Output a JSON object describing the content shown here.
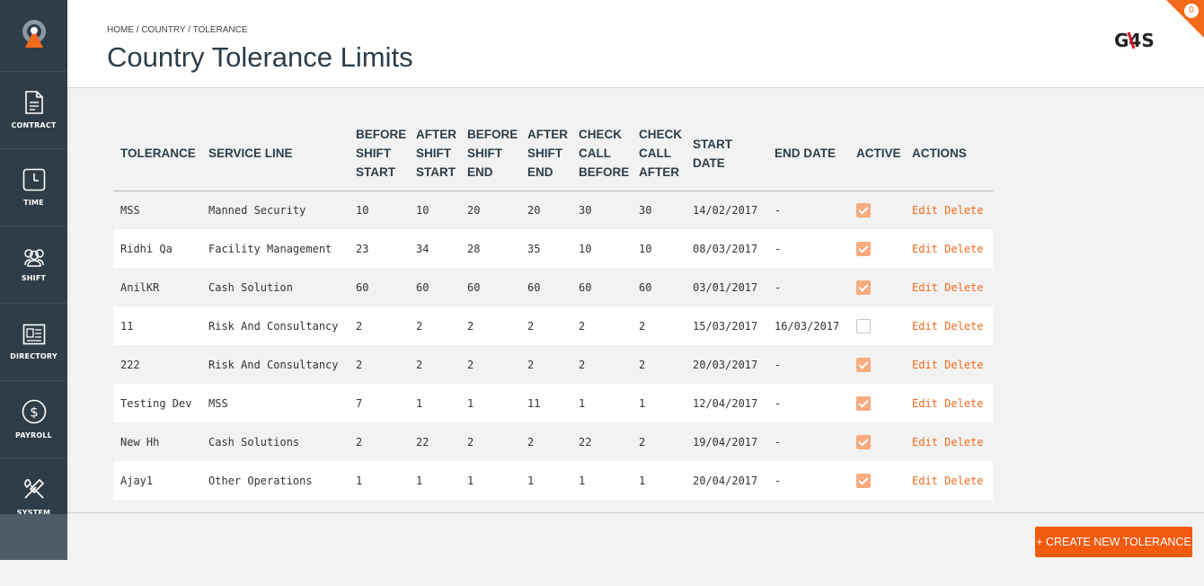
{
  "sidebar": {
    "items": [
      {
        "label": "CONTRACT",
        "icon": "document-icon"
      },
      {
        "label": "TIME",
        "icon": "clock-icon"
      },
      {
        "label": "SHIFT",
        "icon": "users-icon"
      },
      {
        "label": "DIRECTORY",
        "icon": "id-card-icon"
      },
      {
        "label": "PAYROLL",
        "icon": "dollar-icon"
      },
      {
        "label": "SYSTEM",
        "icon": "tools-icon"
      }
    ]
  },
  "header": {
    "breadcrumb": "HOME / COUNTRY / TOLERANCE",
    "title": "Country Tolerance Limits",
    "logo_text": "G4S",
    "notification_count": "0"
  },
  "colors": {
    "accent": "#f26a1b",
    "sidebar": "#2e3d47",
    "check_active": "#f7ab7e"
  },
  "table": {
    "headers": [
      "TOLERANCE",
      "SERVICE LINE",
      "BEFORE SHIFT START",
      "AFTER SHIFT START",
      "BEFORE SHIFT END",
      "AFTER SHIFT END",
      "CHECK CALL BEFORE",
      "CHECK CALL AFTER",
      "START DATE",
      "END DATE",
      "ACTIVE",
      "ACTIONS"
    ],
    "edit_label": "Edit",
    "delete_label": "Delete",
    "rows": [
      {
        "tolerance": "MSS",
        "service_line": "Manned Security",
        "bss": "10",
        "ass": "10",
        "bse": "20",
        "ase": "20",
        "ccb": "30",
        "cca": "30",
        "start": "14/02/2017",
        "end": "-",
        "active": true
      },
      {
        "tolerance": "Ridhi Qa",
        "service_line": "Facility Management",
        "bss": "23",
        "ass": "34",
        "bse": "28",
        "ase": "35",
        "ccb": "10",
        "cca": "10",
        "start": "08/03/2017",
        "end": "-",
        "active": true
      },
      {
        "tolerance": "AnilKR",
        "service_line": "Cash Solution",
        "bss": "60",
        "ass": "60",
        "bse": "60",
        "ase": "60",
        "ccb": "60",
        "cca": "60",
        "start": "03/01/2017",
        "end": "-",
        "active": true
      },
      {
        "tolerance": "11",
        "service_line": "Risk And Consultancy",
        "bss": "2",
        "ass": "2",
        "bse": "2",
        "ase": "2",
        "ccb": "2",
        "cca": "2",
        "start": "15/03/2017",
        "end": "16/03/2017",
        "active": false
      },
      {
        "tolerance": "222",
        "service_line": "Risk And Consultancy",
        "bss": "2",
        "ass": "2",
        "bse": "2",
        "ase": "2",
        "ccb": "2",
        "cca": "2",
        "start": "20/03/2017",
        "end": "-",
        "active": true
      },
      {
        "tolerance": "Testing Dev",
        "service_line": "MSS",
        "bss": "7",
        "ass": "1",
        "bse": "1",
        "ase": "11",
        "ccb": "1",
        "cca": "1",
        "start": "12/04/2017",
        "end": "-",
        "active": true
      },
      {
        "tolerance": "New Hh",
        "service_line": "Cash Solutions",
        "bss": "2",
        "ass": "22",
        "bse": "2",
        "ase": "2",
        "ccb": "22",
        "cca": "2",
        "start": "19/04/2017",
        "end": "-",
        "active": true
      },
      {
        "tolerance": "Ajay1",
        "service_line": "Other Operations",
        "bss": "1",
        "ass": "1",
        "bse": "1",
        "ase": "1",
        "ccb": "1",
        "cca": "1",
        "start": "20/04/2017",
        "end": "-",
        "active": true
      }
    ]
  },
  "footer": {
    "create_label": "+ CREATE NEW TOLERANCE"
  }
}
